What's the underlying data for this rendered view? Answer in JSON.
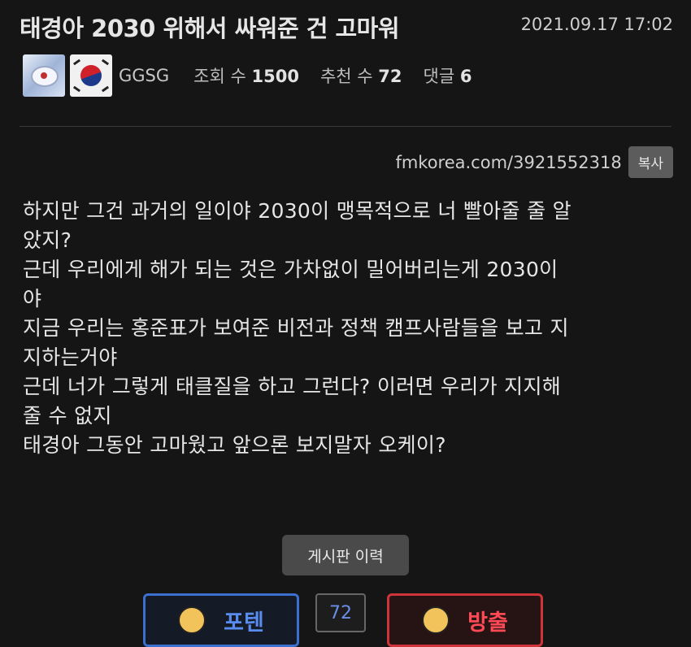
{
  "post": {
    "title": "태경아 2030 위해서 싸워준 건 고마워",
    "date": "2021.09.17 17:02"
  },
  "meta": {
    "nickname": "GGSG",
    "views_label": "조회 수",
    "views": "1500",
    "recommend_label": "추천 수",
    "recommend": "72",
    "comments_label": "댓글",
    "comments": "6"
  },
  "link": {
    "url": "fmkorea.com/3921552318",
    "copy_label": "복사"
  },
  "content": {
    "lines": [
      "하지만 그건 과거의 일이야 2030이 맹목적으로 너 빨아줄 줄 알",
      "았지?",
      "근데 우리에게 해가 되는 것은 가차없이 밀어버리는게 2030이",
      "야",
      "지금 우리는 홍준표가 보여준 비전과 정책 캠프사람들을 보고 지",
      "지하는거야",
      "근데 너가 그렇게 태클질을 하고 그런다? 이러면 우리가 지지해",
      "줄 수 없지",
      "태경아 그동안 고마웠고 앞으론 보지말자 오케이?"
    ]
  },
  "actions": {
    "history_label": "게시판 이력",
    "upvote_label": "포텐",
    "vote_count": "72",
    "downvote_label": "방출"
  },
  "colors": {
    "background": "#151515",
    "upvote": "#3b6fd0",
    "downvote": "#d0343b"
  },
  "icons": [
    "level-badge-icon",
    "korean-flag-icon",
    "thumbs-up-face-icon",
    "thumbs-down-face-icon"
  ]
}
